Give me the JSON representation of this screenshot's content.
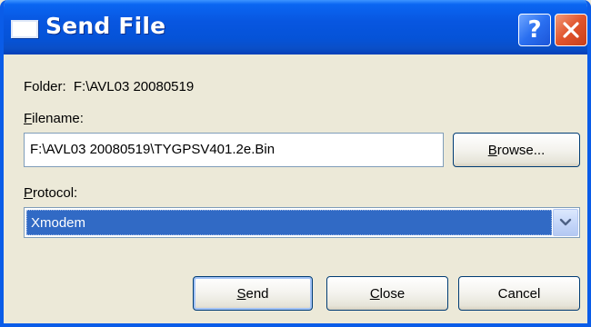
{
  "window": {
    "title": "Send File"
  },
  "folder": {
    "label": "Folder:",
    "value": "F:\\AVL03 20080519"
  },
  "filename": {
    "label_first": "F",
    "label_rest": "ilename:",
    "value": "F:\\AVL03 20080519\\TYGPSV401.2e.Bin",
    "browse_first": "B",
    "browse_rest": "rowse..."
  },
  "protocol": {
    "label_first": "P",
    "label_rest": "rotocol:",
    "selected": "Xmodem"
  },
  "buttons": {
    "send_first": "S",
    "send_rest": "end",
    "close_first": "C",
    "close_rest": "lose",
    "cancel": "Cancel"
  },
  "colors": {
    "titlebar": "#0553d8",
    "selection": "#316ac5",
    "close_button": "#e0542c",
    "help_button": "#2a6ff0"
  },
  "icons": {
    "title_icon": "window-icon",
    "help": "question-mark-icon",
    "close": "x-icon",
    "dropdown": "chevron-down-icon"
  }
}
